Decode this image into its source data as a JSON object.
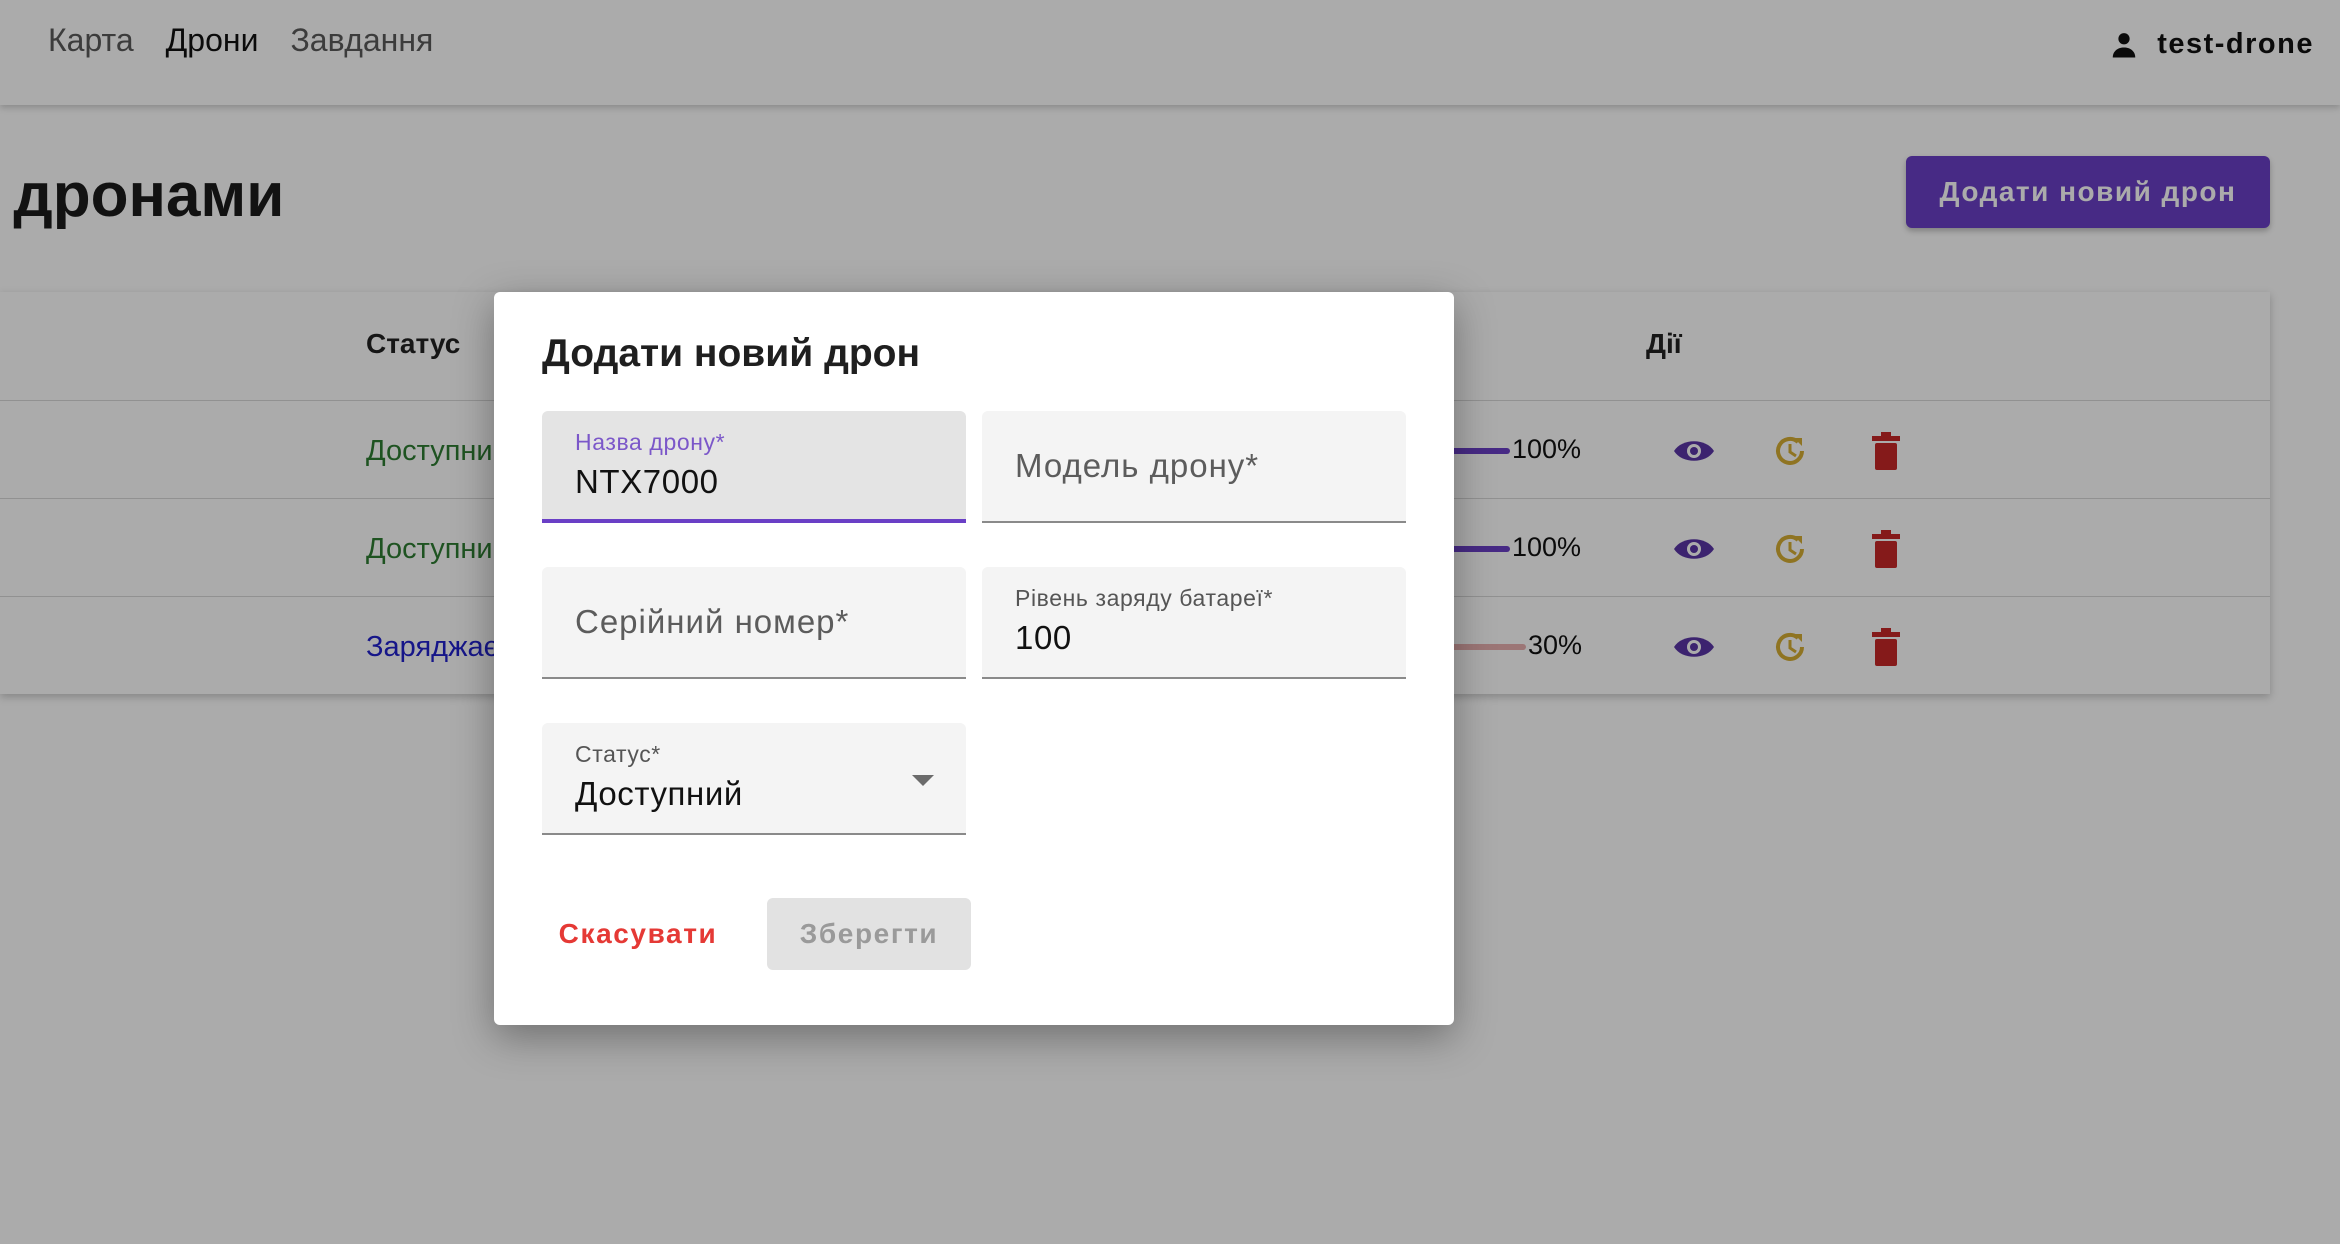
{
  "nav": {
    "items": [
      {
        "label": "Карта"
      },
      {
        "label": "Дрони"
      },
      {
        "label": "Завдання"
      }
    ]
  },
  "user": {
    "name": "test-drone",
    "icon": "person-icon"
  },
  "page": {
    "title": "я дронами",
    "add_button": "Додати новий дрон"
  },
  "table": {
    "headers": {
      "status": "Статус",
      "actions": "Дії"
    },
    "rows": [
      {
        "status": "Доступний",
        "status_color": "#2e7d32",
        "battery_percent": 100,
        "battery_label": "100%"
      },
      {
        "status": "Доступний",
        "status_color": "#2e7d32",
        "battery_percent": 100,
        "battery_label": "100%"
      },
      {
        "status": "Заряджається",
        "status_color": "#2222cc",
        "battery_percent": 30,
        "battery_label": "30%"
      }
    ],
    "action_icons": [
      "eye-icon",
      "history-icon",
      "trash-icon"
    ]
  },
  "dialog": {
    "title": "Додати новий дрон",
    "fields": {
      "name": {
        "label": "Назва дрону*",
        "value": "NTX7000"
      },
      "model": {
        "placeholder": "Модель дрону*"
      },
      "serial": {
        "placeholder": "Серійний номер*"
      },
      "battery": {
        "label": "Рівень заряду батареї*",
        "value": "100"
      },
      "status": {
        "label": "Статус*",
        "value": "Доступний"
      }
    },
    "cancel_label": "Скасувати",
    "save_label": "Зберегти"
  },
  "colors": {
    "accent": "#6a3fc6",
    "available": "#2e7d32",
    "charging": "#2222cc",
    "danger": "#e53935",
    "history": "#f0c23b"
  }
}
